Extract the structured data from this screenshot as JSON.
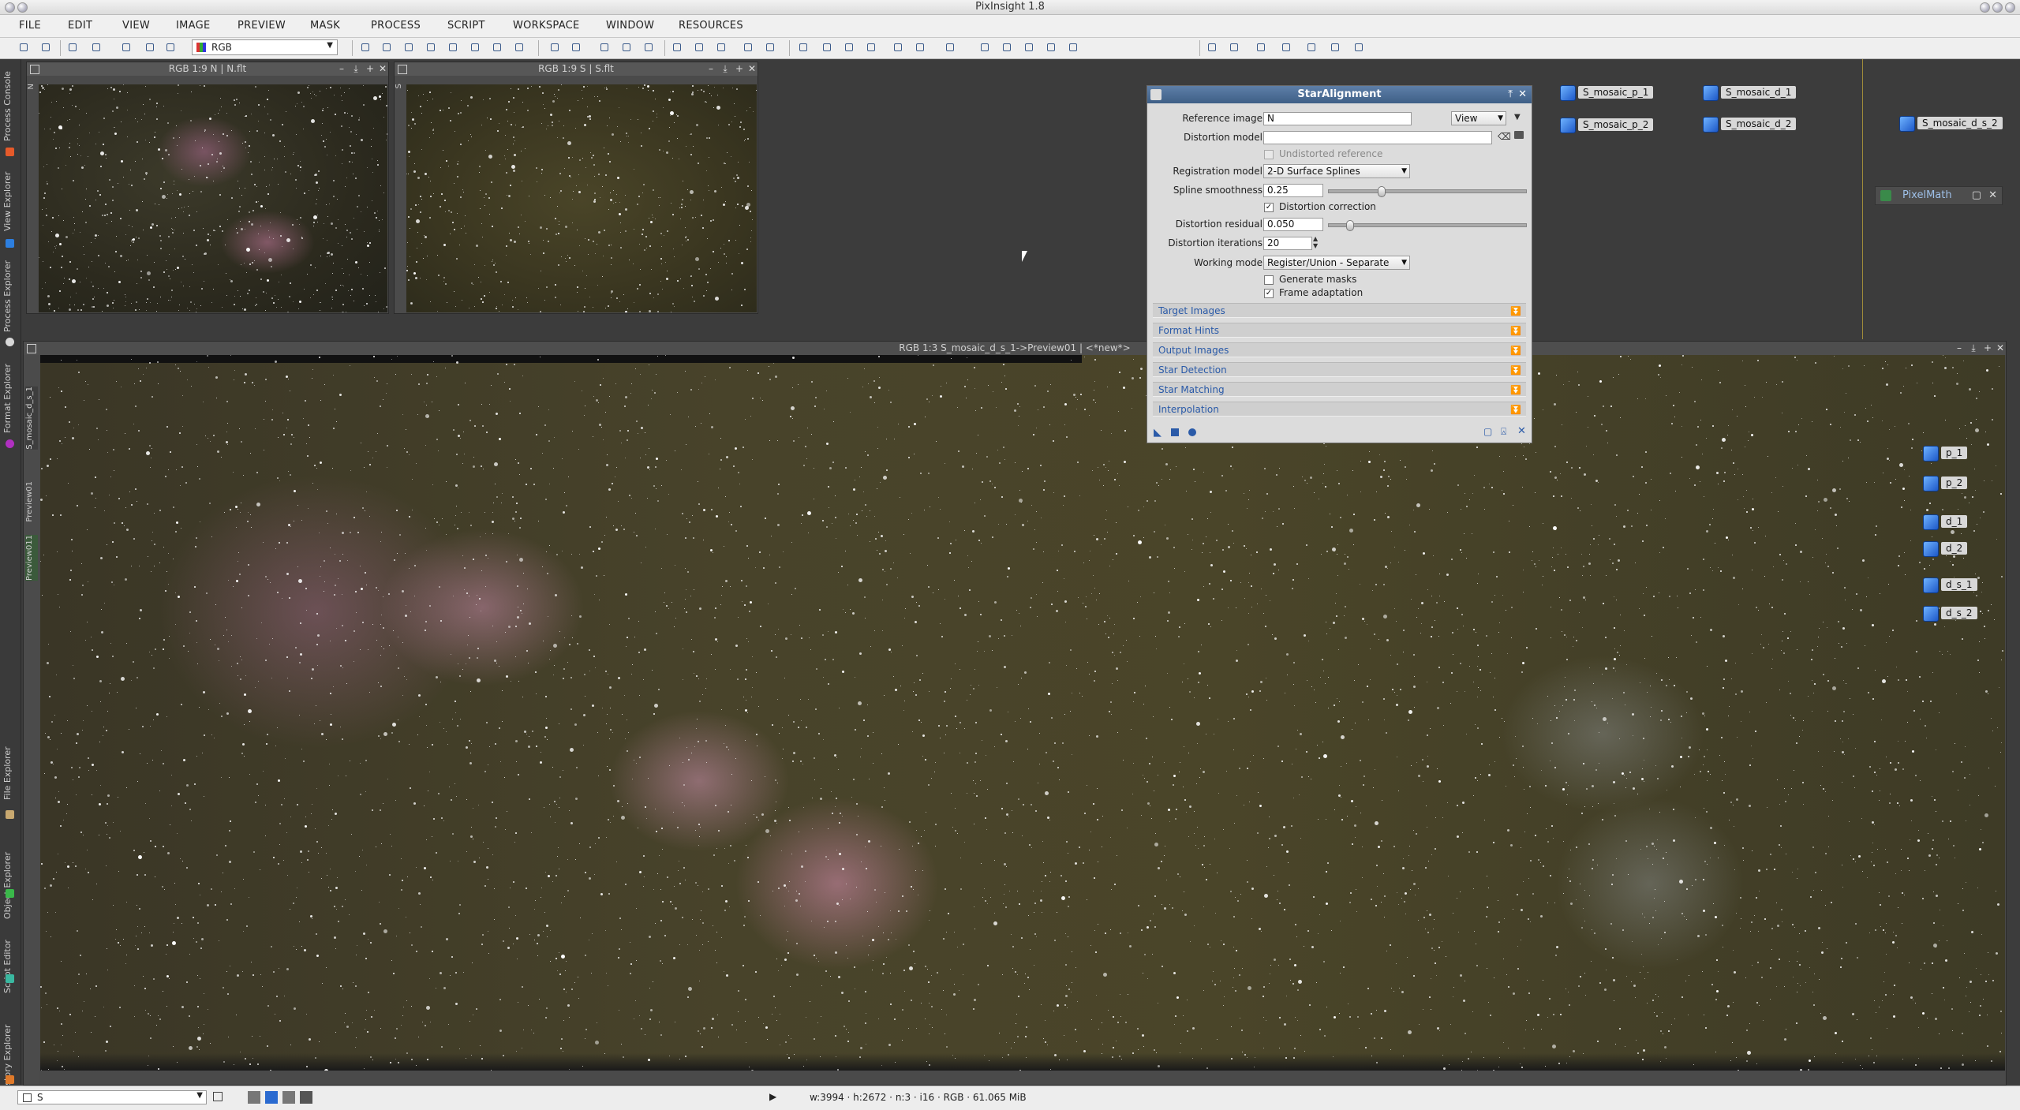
{
  "window": {
    "title": "PixInsight 1.8"
  },
  "menu": [
    "FILE",
    "EDIT",
    "VIEW",
    "IMAGE",
    "PREVIEW",
    "MASK",
    "PROCESS",
    "SCRIPT",
    "WORKSPACE",
    "WINDOW",
    "RESOURCES"
  ],
  "toolbar": {
    "rgb_select": "RGB"
  },
  "leftdock": [
    "Process Console",
    "View Explorer",
    "Process Explorer",
    "Format Explorer",
    "File Explorer",
    "Object Explorer",
    "Script Editor",
    "History Explorer"
  ],
  "windows": {
    "n": {
      "title": "RGB 1:9 N | N.flt",
      "side_tab": "N"
    },
    "s": {
      "title": "RGB 1:9 S | S.flt",
      "side_tab": "S"
    },
    "main": {
      "title": "RGB 1:3 S_mosaic_d_s_1->Preview01 | <*new*>",
      "tab_main": "S_mosaic_d_s_1",
      "tab_preview01": "Preview01",
      "tab_preview011": "Preview011"
    }
  },
  "dialog": {
    "title": "StarAlignment",
    "reference_label": "Reference image:",
    "reference_value": "N",
    "reference_mode": "View",
    "distortion_model_label": "Distortion model:",
    "distortion_model_value": "",
    "undistorted_label": "Undistorted reference",
    "registration_label": "Registration model:",
    "registration_value": "2-D Surface Splines",
    "spline_label": "Spline smoothness:",
    "spline_value": "0.25",
    "distortion_correction_label": "Distortion correction",
    "residual_label": "Distortion residual:",
    "residual_value": "0.050",
    "iterations_label": "Distortion iterations:",
    "iterations_value": "20",
    "working_mode_label": "Working mode:",
    "working_mode_value": "Register/Union - Separate",
    "generate_masks_label": "Generate masks",
    "frame_adaptation_label": "Frame adaptation",
    "sections": [
      "Target Images",
      "Format Hints",
      "Output Images",
      "Star Detection",
      "Star Matching",
      "Interpolation"
    ]
  },
  "process_icons_top": [
    {
      "label": "S_mosaic_p_1"
    },
    {
      "label": "S_mosaic_d_1"
    },
    {
      "label": "S_mosaic_p_2"
    },
    {
      "label": "S_mosaic_d_2"
    },
    {
      "label": "S_mosaic_d_s_2"
    }
  ],
  "process_icons_right": [
    {
      "label": "p_1"
    },
    {
      "label": "p_2"
    },
    {
      "label": "d_1"
    },
    {
      "label": "d_2"
    },
    {
      "label": "d_s_1"
    },
    {
      "label": "d_s_2"
    }
  ],
  "pixelmath": {
    "label": "PixelMath"
  },
  "status": {
    "view_select": "S",
    "info": "w:3994 · h:2672 · n:3 · i16 · RGB · 61.065 MiB"
  }
}
